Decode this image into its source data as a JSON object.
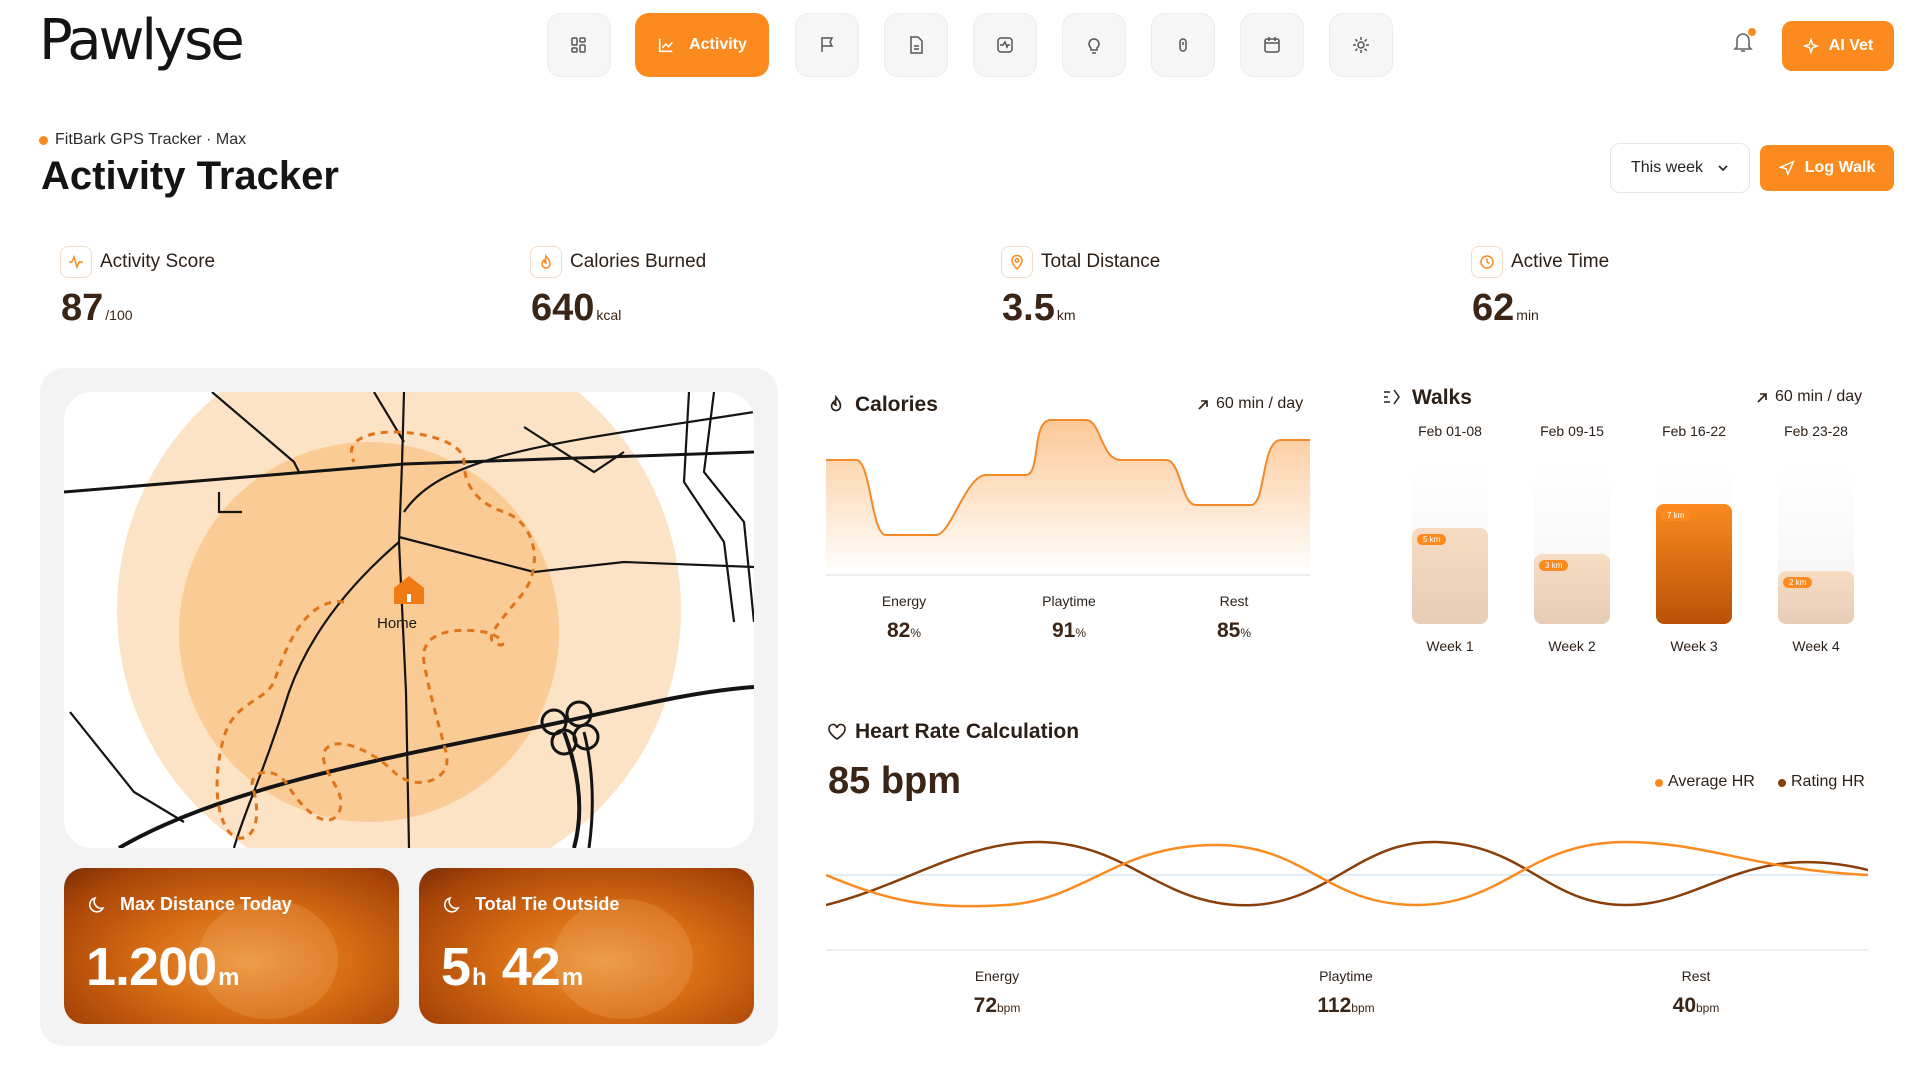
{
  "app": {
    "logo": "Pawlyse",
    "ai_vet_label": "AI Vet"
  },
  "nav": {
    "active_label": "Activity"
  },
  "page": {
    "subtitle": "FitBark GPS Tracker · Max",
    "title": "Activity Tracker",
    "week_select": "This week",
    "log_walk": "Log Walk"
  },
  "stats": [
    {
      "label": "Activity Score",
      "value": "87",
      "unit": "/100"
    },
    {
      "label": "Calories Burned",
      "value": "640",
      "unit": "kcal"
    },
    {
      "label": "Total Distance",
      "value": "3.5",
      "unit": "km"
    },
    {
      "label": "Active Time",
      "value": "62",
      "unit": "min"
    }
  ],
  "map": {
    "home_label": "Home"
  },
  "metrics": [
    {
      "label": "Max Distance Today",
      "value": "1.200",
      "unit": "m"
    },
    {
      "label": "Total Tie Outside",
      "hours": "5",
      "hours_unit": "h",
      "minutes": "42",
      "minutes_unit": "m"
    }
  ],
  "calories": {
    "title": "Calories",
    "goal": "60 min / day",
    "items": [
      {
        "label": "Energy",
        "value": "82",
        "unit": "%"
      },
      {
        "label": "Playtime",
        "value": "91",
        "unit": "%"
      },
      {
        "label": "Rest",
        "value": "85",
        "unit": "%"
      }
    ]
  },
  "walks": {
    "title": "Walks",
    "goal": "60 min / day",
    "columns": [
      {
        "date": "Feb 01-08",
        "week": "Week 1",
        "tag": "5 km",
        "fill": 0.6
      },
      {
        "date": "Feb 09-15",
        "week": "Week 2",
        "tag": "3 km",
        "fill": 0.44
      },
      {
        "date": "Feb 16-22",
        "week": "Week 3",
        "tag": "7 km",
        "fill": 0.75
      },
      {
        "date": "Feb 23-28",
        "week": "Week 4",
        "tag": "2 km",
        "fill": 0.33
      }
    ]
  },
  "heart": {
    "title": "Heart Rate Calculation",
    "value": "85 bpm",
    "legend": [
      {
        "label": "Average HR",
        "color": "#fb8a1f"
      },
      {
        "label": "Rating HR",
        "color": "#8a3f0a"
      }
    ],
    "items": [
      {
        "label": "Energy",
        "value": "72",
        "unit": "bpm"
      },
      {
        "label": "Playtime",
        "value": "112",
        "unit": "bpm"
      },
      {
        "label": "Rest",
        "value": "40",
        "unit": "bpm"
      }
    ]
  },
  "colors": {
    "accent": "#fb8a1f",
    "dark_brown": "#8a3f0a"
  }
}
